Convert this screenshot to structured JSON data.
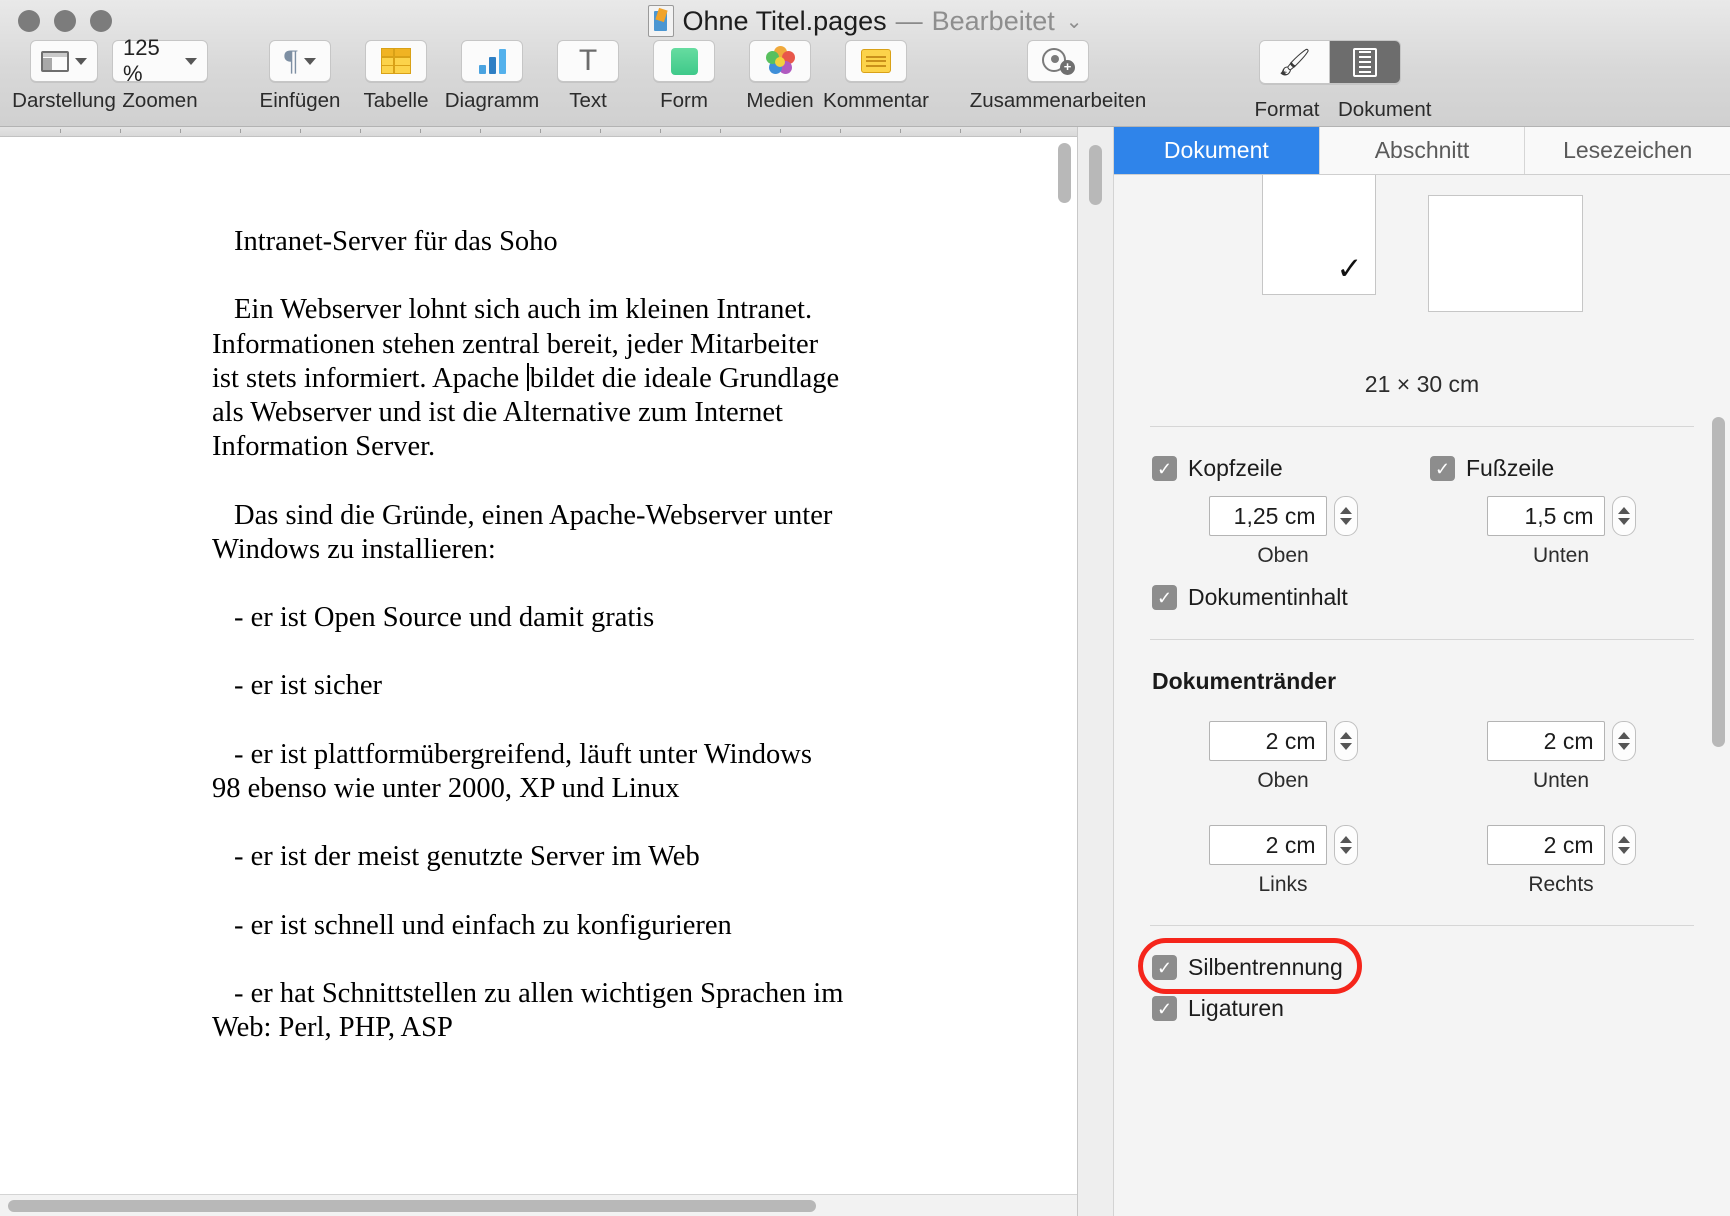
{
  "window": {
    "title": "Ohne Titel.pages",
    "title_separator": "—",
    "edited_state": "Bearbeitet",
    "title_chevron": "⌄",
    "app_icon": "pages-document-icon"
  },
  "toolbar": {
    "items": [
      {
        "label": "Darstellung",
        "icon": "view-layout-icon",
        "has_chevron": true
      },
      {
        "label": "Zoomen",
        "icon": "zoom-value",
        "value": "125 %",
        "has_chevron": true
      },
      {
        "label": "Einfügen",
        "icon": "pilcrow-icon",
        "has_chevron": true
      },
      {
        "label": "Tabelle",
        "icon": "table-icon",
        "has_chevron": false
      },
      {
        "label": "Diagramm",
        "icon": "bar-chart-icon",
        "has_chevron": false
      },
      {
        "label": "Text",
        "icon": "text-box-icon",
        "has_chevron": false
      },
      {
        "label": "Form",
        "icon": "shape-icon",
        "has_chevron": false
      },
      {
        "label": "Medien",
        "icon": "photos-flower-icon",
        "has_chevron": false
      },
      {
        "label": "Kommentar",
        "icon": "comment-note-icon",
        "has_chevron": false
      },
      {
        "label": "Zusammenarbeiten",
        "icon": "add-person-icon",
        "has_chevron": false
      }
    ],
    "right_segment": {
      "format_label": "Format",
      "format_icon": "paint-brush-icon",
      "document_label": "Dokument",
      "document_icon": "document-panel-icon",
      "active": "Dokument"
    }
  },
  "document": {
    "paragraphs": [
      {
        "id": "heading",
        "text": "Intranet-Server für das Soho"
      },
      {
        "id": "intro_a",
        "text": "Ein Webserver lohnt sich auch im kleinen Intranet. Informationen stehen zentral bereit, jeder Mitarbeiter ist stets informiert. Apache "
      },
      {
        "id": "intro_b",
        "text": "bildet die ideale Grundlage als Webserver und ist die Alternative zum Internet Information Server."
      },
      {
        "id": "reasons_lead",
        "text": "Das sind die Gründe, einen Apache-Webserver unter Windows zu installieren:"
      },
      {
        "id": "bullet_1",
        "text": "- er ist Open Source und damit gratis"
      },
      {
        "id": "bullet_2",
        "text": "- er ist sicher"
      },
      {
        "id": "bullet_3",
        "text": "- er ist plattformübergreifend, läuft unter Windows 98 ebenso wie unter 2000, XP und Linux"
      },
      {
        "id": "bullet_4",
        "text": "- er ist der meist genutzte Server im Web"
      },
      {
        "id": "bullet_5",
        "text": "- er ist schnell und einfach zu konfigurieren"
      },
      {
        "id": "bullet_6",
        "text": "- er hat Schnittstellen zu allen wichtigen Sprachen im Web: Perl, PHP, ASP"
      }
    ],
    "caret_present": true
  },
  "inspector": {
    "tabs": [
      {
        "label": "Dokument",
        "active": true
      },
      {
        "label": "Abschnitt",
        "active": false
      },
      {
        "label": "Lesezeichen",
        "active": false
      }
    ],
    "orientation": {
      "portrait_selected": true,
      "checkmark": "✓",
      "page_size": "21 × 30 cm"
    },
    "header_footer": {
      "header": {
        "label": "Kopfzeile",
        "checked": true,
        "value": "1,25 cm",
        "sublabel": "Oben"
      },
      "footer": {
        "label": "Fußzeile",
        "checked": true,
        "value": "1,5 cm",
        "sublabel": "Unten"
      },
      "document_body": {
        "label": "Dokumentinhalt",
        "checked": true
      }
    },
    "margins": {
      "title": "Dokumentränder",
      "top": {
        "value": "2 cm",
        "sublabel": "Oben"
      },
      "bottom": {
        "value": "2 cm",
        "sublabel": "Unten"
      },
      "left": {
        "value": "2 cm",
        "sublabel": "Links"
      },
      "right": {
        "value": "2 cm",
        "sublabel": "Rechts"
      }
    },
    "typography": {
      "hyphenation": {
        "label": "Silbentrennung",
        "checked": true,
        "highlighted": true
      },
      "ligatures": {
        "label": "Ligaturen",
        "checked": true,
        "highlighted": false
      }
    },
    "highlight_color": "#f5251b",
    "accent_color": "#2f84ea"
  }
}
